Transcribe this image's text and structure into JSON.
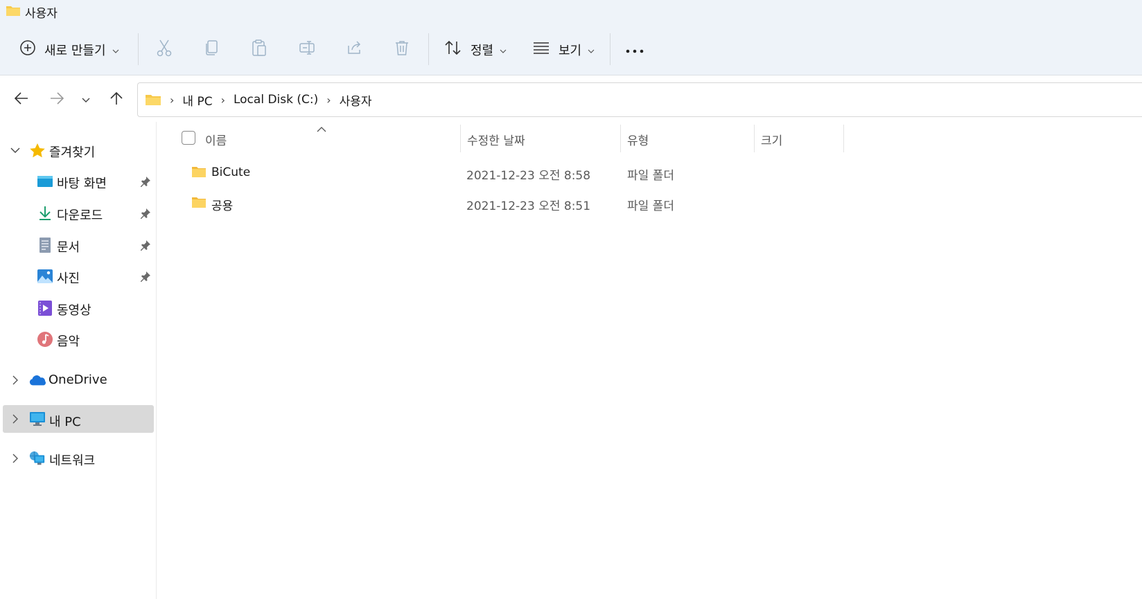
{
  "window": {
    "title": "사용자"
  },
  "toolbar": {
    "new_label": "새로 만들기",
    "sort_label": "정렬",
    "view_label": "보기",
    "icons": [
      "plus-circle-icon",
      "cut-icon",
      "copy-icon",
      "paste-icon",
      "rename-icon",
      "share-icon",
      "delete-icon",
      "sort-icon",
      "view-icon",
      "more-icon"
    ]
  },
  "breadcrumb": {
    "items": [
      "내 PC",
      "Local Disk (C:)",
      "사용자"
    ]
  },
  "sidebar": {
    "favorites": {
      "label": "즐겨찾기",
      "expanded": true
    },
    "items": [
      {
        "label": "바탕 화면",
        "icon": "desktop-icon",
        "pinned": true
      },
      {
        "label": "다운로드",
        "icon": "download-icon",
        "pinned": true
      },
      {
        "label": "문서",
        "icon": "document-icon",
        "pinned": true
      },
      {
        "label": "사진",
        "icon": "pictures-icon",
        "pinned": true
      },
      {
        "label": "동영상",
        "icon": "video-icon",
        "pinned": false
      },
      {
        "label": "음악",
        "icon": "music-icon",
        "pinned": false
      }
    ],
    "onedrive": {
      "label": "OneDrive"
    },
    "thispc": {
      "label": "내 PC",
      "selected": true
    },
    "network": {
      "label": "네트워크"
    }
  },
  "columns": {
    "name": "이름",
    "date": "수정한 날짜",
    "type": "유형",
    "size": "크기"
  },
  "files": [
    {
      "name": "BiCute",
      "date": "2021-12-23 오전 8:58",
      "type": "파일 폴더"
    },
    {
      "name": "공용",
      "date": "2021-12-23 오전 8:51",
      "type": "파일 폴더"
    }
  ],
  "colors": {
    "toolbar_bg": "#eef3f9",
    "selected_bg": "#d9d9d9",
    "folder_yellow": "#f7c94a",
    "accent": "#2b74cf"
  }
}
